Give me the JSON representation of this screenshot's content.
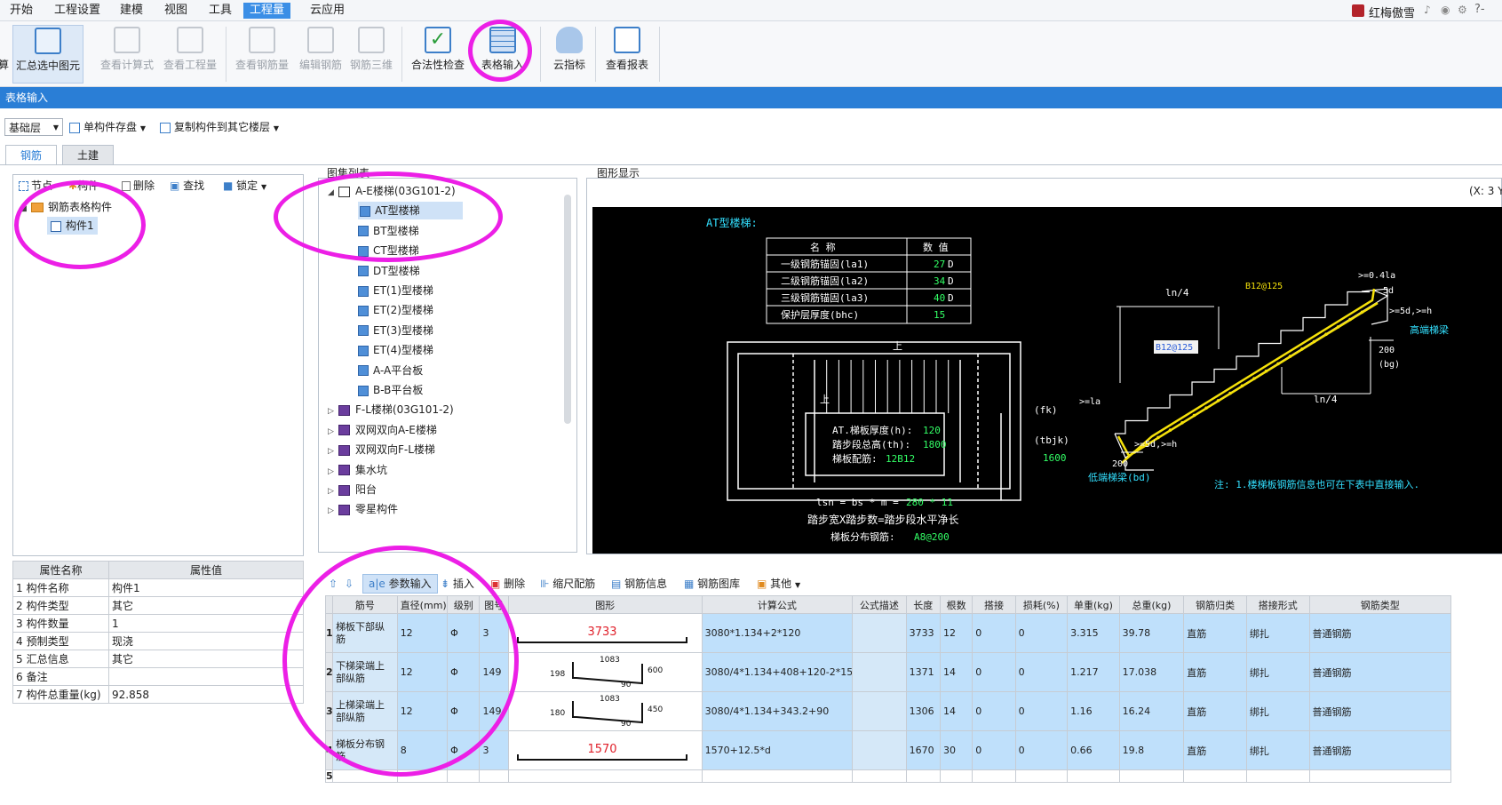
{
  "menu": [
    "开始",
    "工程设置",
    "建模",
    "视图",
    "工具",
    "工程量",
    "云应用"
  ],
  "menu_active_index": 5,
  "user": {
    "name": "红梅傲雪"
  },
  "window_controls": "?-",
  "ribbon": [
    {
      "label": "算",
      "disabled": false
    },
    {
      "label": "汇总选中图元",
      "disabled": false
    },
    {
      "label": "查看计算式",
      "disabled": true
    },
    {
      "label": "查看工程量",
      "disabled": true
    },
    {
      "label": "查看钢筋量",
      "disabled": true
    },
    {
      "label": "编辑钢筋",
      "disabled": true
    },
    {
      "label": "钢筋三维",
      "disabled": true
    },
    {
      "label": "合法性检查",
      "disabled": false
    },
    {
      "label": "表格输入",
      "disabled": false
    },
    {
      "label": "云指标",
      "disabled": false
    },
    {
      "label": "查看报表",
      "disabled": false
    }
  ],
  "title_bar": "表格输入",
  "toolbar2": {
    "floor": "基础层",
    "save_btn": "单构件存盘",
    "copy_btn": "复制构件到其它楼层"
  },
  "tabs": [
    "钢筋",
    "土建"
  ],
  "left_toolbar": [
    "节点",
    "构件",
    "删除",
    "查找",
    "锁定"
  ],
  "left_tree": {
    "root": "钢筋表格构件",
    "child": "构件1"
  },
  "props": {
    "headers": [
      "属性名称",
      "属性值"
    ],
    "rows": [
      [
        "1",
        "构件名称",
        "构件1"
      ],
      [
        "2",
        "构件类型",
        "其它"
      ],
      [
        "3",
        "构件数量",
        "1"
      ],
      [
        "4",
        "预制类型",
        "现浇"
      ],
      [
        "5",
        "汇总信息",
        "其它"
      ],
      [
        "6",
        "备注",
        ""
      ],
      [
        "7",
        "构件总重量(kg)",
        "92.858"
      ]
    ]
  },
  "atlas": {
    "title": "图集列表",
    "items": [
      {
        "label": "A-E楼梯(03G101-2)",
        "type": "book",
        "level": 0,
        "expanded": true
      },
      {
        "label": "AT型楼梯",
        "type": "doc",
        "level": 1,
        "selected": true
      },
      {
        "label": "BT型楼梯",
        "type": "doc",
        "level": 1
      },
      {
        "label": "CT型楼梯",
        "type": "doc",
        "level": 1
      },
      {
        "label": "DT型楼梯",
        "type": "doc",
        "level": 1
      },
      {
        "label": "ET(1)型楼梯",
        "type": "doc",
        "level": 1
      },
      {
        "label": "ET(2)型楼梯",
        "type": "doc",
        "level": 1
      },
      {
        "label": "ET(3)型楼梯",
        "type": "doc",
        "level": 1
      },
      {
        "label": "ET(4)型楼梯",
        "type": "doc",
        "level": 1
      },
      {
        "label": "A-A平台板",
        "type": "doc",
        "level": 1
      },
      {
        "label": "B-B平台板",
        "type": "doc",
        "level": 1
      },
      {
        "label": "F-L楼梯(03G101-2)",
        "type": "book",
        "level": 0
      },
      {
        "label": "双网双向A-E楼梯",
        "type": "book",
        "level": 0
      },
      {
        "label": "双网双向F-L楼梯",
        "type": "book",
        "level": 0
      },
      {
        "label": "集水坑",
        "type": "book",
        "level": 0
      },
      {
        "label": "阳台",
        "type": "book",
        "level": 0
      },
      {
        "label": "零星构件",
        "type": "book",
        "level": 0
      }
    ]
  },
  "graphic": {
    "title": "图形显示",
    "coord": "(X: 3 Y",
    "drawing_title": "AT型楼梯:",
    "params_headers": [
      "名 称",
      "数 值"
    ],
    "params": [
      [
        "一级钢筋锚固(la1)",
        "27",
        "D"
      ],
      [
        "二级钢筋锚固(la2)",
        "34",
        "D"
      ],
      [
        "三级钢筋锚固(la3)",
        "40",
        "D"
      ],
      [
        "保护层厚度(bhc)",
        "15",
        ""
      ]
    ],
    "plan_labels": {
      "h_label": "AT.梯板厚度(h):",
      "h_value": "120",
      "th_label": "踏步段总高(th):",
      "th_value": "1800",
      "rebar_label": "梯板配筋:",
      "rebar_value": "12B12",
      "fk": "(fk)",
      "tbjk": "(tbjk)",
      "tbjk_value": "1600",
      "lsn_label": "lsn = bs * m =",
      "lsn_value": "280 * 11",
      "step_text": "踏步宽X踏步数=踏步段水平净长",
      "dist_label": "梯板分布钢筋:",
      "dist_value": "A8@200",
      "up": "上"
    },
    "section_labels": {
      "ln4a": "ln/4",
      "ln4b": "ln/4",
      "rebar_top": "B12@125",
      "rebar_mid": "B12@125",
      "ge04la": ">=0.4la",
      "d5": "5d",
      "ge5dh_r": ">=5d,>=h",
      "d200_r": "200",
      "bg": "(bg)",
      "high_beam": "高端梯梁",
      "gela": ">=la",
      "ge5dh_l": ">=5d,>=h",
      "d200_l": "200",
      "low_beam": "低端梯梁(bd)",
      "note": "注: 1.楼梯板钢筋信息也可在下表中直接输入."
    }
  },
  "grid_toolbar": [
    "参数输入",
    "插入",
    "删除",
    "缩尺配筋",
    "钢筋信息",
    "钢筋图库",
    "其他"
  ],
  "grid": {
    "headers": [
      "筋号",
      "直径(mm)",
      "级别",
      "图号",
      "图形",
      "计算公式",
      "公式描述",
      "长度",
      "根数",
      "搭接",
      "损耗(%)",
      "单重(kg)",
      "总重(kg)",
      "钢筋归类",
      "搭接形式",
      "钢筋类型"
    ],
    "rows": [
      {
        "n": "1",
        "name": "梯板下部纵筋",
        "dia": "12",
        "grade": "Φ",
        "fig": "3",
        "shape": {
          "kind": "straight",
          "text": "3733"
        },
        "formula": "3080*1.134+2*120",
        "desc": "",
        "len": "3733",
        "count": "12",
        "lap": "0",
        "loss": "0",
        "unit": "3.315",
        "total": "39.78",
        "cls": "直筋",
        "lapform": "绑扎",
        "type": "普通钢筋"
      },
      {
        "n": "2",
        "name": "下梯梁端上部纵筋",
        "dia": "12",
        "grade": "Φ",
        "fig": "149",
        "shape": {
          "kind": "bent",
          "a": "198",
          "b": "1083",
          "c": "600",
          "d": "90"
        },
        "formula": "3080/4*1.134+408+120-2*15",
        "desc": "",
        "len": "1371",
        "count": "14",
        "lap": "0",
        "loss": "0",
        "unit": "1.217",
        "total": "17.038",
        "cls": "直筋",
        "lapform": "绑扎",
        "type": "普通钢筋"
      },
      {
        "n": "3",
        "name": "上梯梁端上部纵筋",
        "dia": "12",
        "grade": "Φ",
        "fig": "149",
        "shape": {
          "kind": "bent",
          "a": "180",
          "b": "1083",
          "c": "450",
          "d": "90"
        },
        "formula": "3080/4*1.134+343.2+90",
        "desc": "",
        "len": "1306",
        "count": "14",
        "lap": "0",
        "loss": "0",
        "unit": "1.16",
        "total": "16.24",
        "cls": "直筋",
        "lapform": "绑扎",
        "type": "普通钢筋"
      },
      {
        "n": "4",
        "name": "梯板分布钢筋",
        "dia": "8",
        "grade": "Φ",
        "fig": "3",
        "shape": {
          "kind": "straight",
          "text": "1570"
        },
        "formula": "1570+12.5*d",
        "desc": "",
        "len": "1670",
        "count": "30",
        "lap": "0",
        "loss": "0",
        "unit": "0.66",
        "total": "19.8",
        "cls": "直筋",
        "lapform": "绑扎",
        "type": "普通钢筋"
      }
    ],
    "empty_row_no": "5"
  },
  "colors": {
    "accent": "#2a7ed6",
    "highlight_ring": "#ec1fe6",
    "selection": "#bfe0fb",
    "drawing_bg": "#000000",
    "drawing_lines": "#ffffff",
    "drawing_yellow": "#f5e10a",
    "drawing_cyan": "#33e0ff",
    "drawing_green": "#33ff66",
    "shape_red": "#e0202a"
  }
}
